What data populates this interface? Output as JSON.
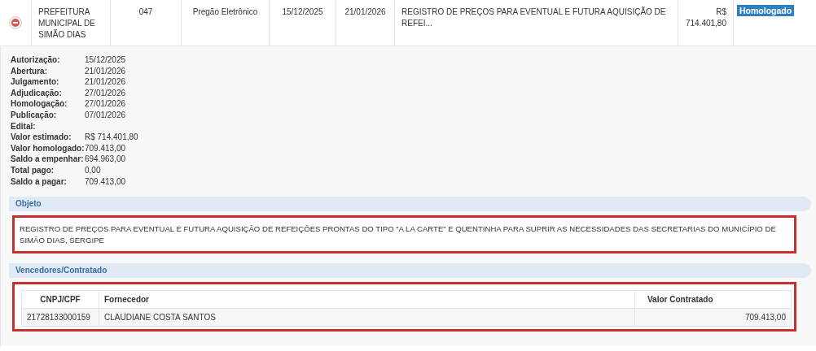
{
  "row": {
    "orgao": "PREFEITURA MUNICIPAL DE SIMÃO DIAS",
    "numero": "047",
    "modalidade": "Pregão Eletrônico",
    "data_1": "15/12/2025",
    "data_2": "21/01/2026",
    "objeto": "REGISTRO DE PREÇOS PARA EVENTUAL E FUTURA AQUISIÇÃO DE REFEI...",
    "valor": "R$ 714.401,80",
    "status": "Homologado",
    "expanded": true
  },
  "details": [
    {
      "label": "Autorização:",
      "value": "15/12/2025"
    },
    {
      "label": "Abertura:",
      "value": "21/01/2026"
    },
    {
      "label": "Julgamento:",
      "value": "21/01/2026"
    },
    {
      "label": "Adjudicação:",
      "value": "27/01/2026"
    },
    {
      "label": "Homologação:",
      "value": "27/01/2026"
    },
    {
      "label": "Publicação:",
      "value": "07/01/2026"
    },
    {
      "label": "Edital:"
    },
    {
      "label": "Valor estimado:",
      "value": "R$ 714.401,80"
    },
    {
      "label": "Valor homologado:",
      "value": "709.413,00"
    },
    {
      "label": "Saldo a empenhar:",
      "value": "694.963,00"
    },
    {
      "label": "Total pago:",
      "value": "0,00"
    },
    {
      "label": "Saldo a pagar:",
      "value": "709.413,00"
    }
  ],
  "objeto": {
    "title": "Objeto",
    "text": "REGISTRO DE PREÇOS PARA EVENTUAL E FUTURA AQUISIÇÃO DE REFEIÇÕES PRONTAS DO TIPO “A LA CARTE” E QUENTINHA PARA SUPRIR AS NECESSIDADES DAS SECRETARIAS DO MUNICÍPIO DE SIMÃO DIAS, SERGIPE"
  },
  "vencedores": {
    "title": "Vencedores/Contratado",
    "columns": [
      "CNPJ/CPF",
      "Fornecedor",
      "Valor Contratado"
    ],
    "rows": [
      [
        "21728133000159",
        "CLAUDIANE COSTA SANTOS",
        "709.413,00"
      ]
    ]
  }
}
